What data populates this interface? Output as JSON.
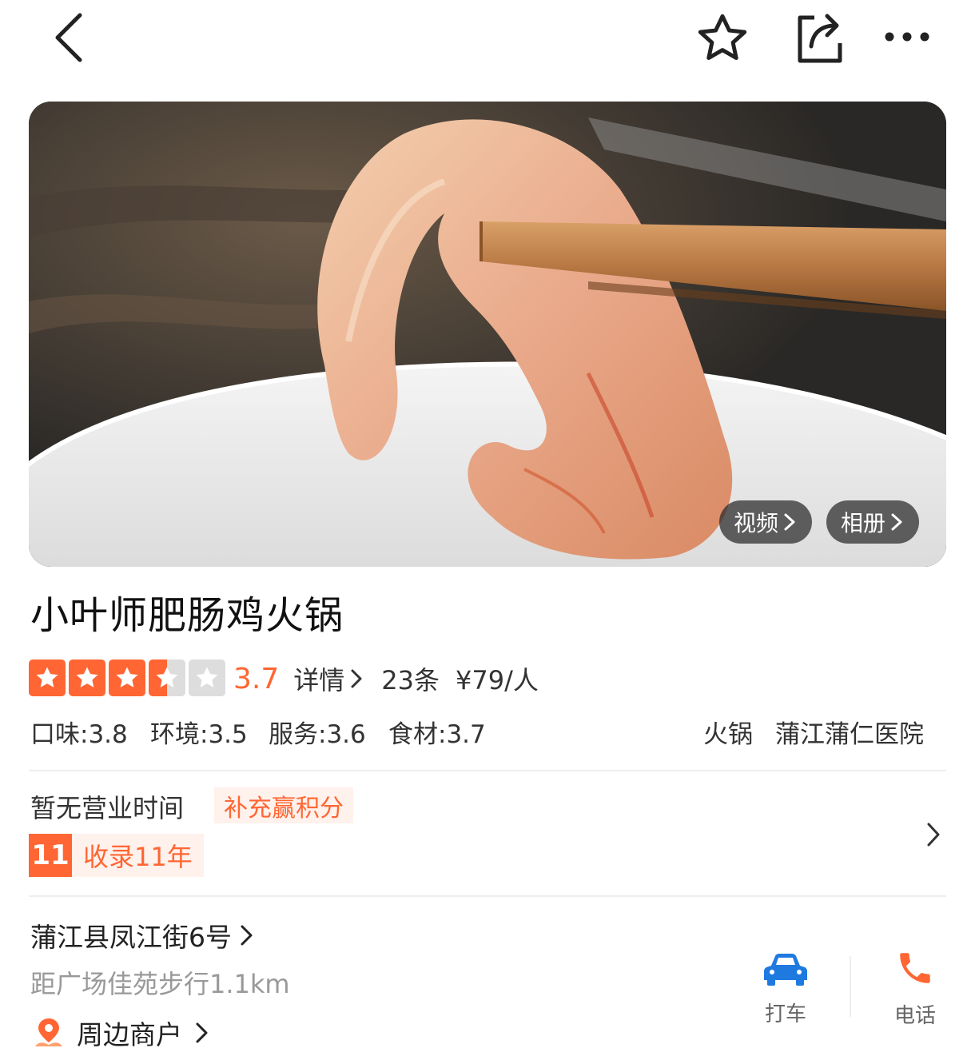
{
  "topbar": {
    "back_icon": "chevron-left-icon",
    "favorite_icon": "star-outline-icon",
    "share_icon": "share-icon",
    "more_icon": "more-dots-icon"
  },
  "hero": {
    "video_label": "视频",
    "album_label": "相册"
  },
  "shop": {
    "name": "小叶师肥肠鸡火锅",
    "rating": "3.7",
    "rating_value": 3.7,
    "star_color": "#ff6633",
    "details_label": "详情",
    "review_count": "23条",
    "price": "¥79/人",
    "sub_scores": [
      "口味:3.8",
      "环境:3.5",
      "服务:3.6",
      "食材:3.7"
    ],
    "category": "火锅",
    "area": "蒲江蒲仁医院"
  },
  "hours": {
    "text": "暂无营业时间",
    "bonus_tag": "补充赢积分",
    "years_number": "11",
    "years_label": "收录11年"
  },
  "location": {
    "address": "蒲江县凤江街6号",
    "distance": "距广场佳苑步行1.1km",
    "nearby": "周边商户"
  },
  "actions": {
    "taxi_label": "打车",
    "phone_label": "电话"
  },
  "colors": {
    "accent": "#ff6633",
    "taxi_blue": "#1f7ae0"
  }
}
